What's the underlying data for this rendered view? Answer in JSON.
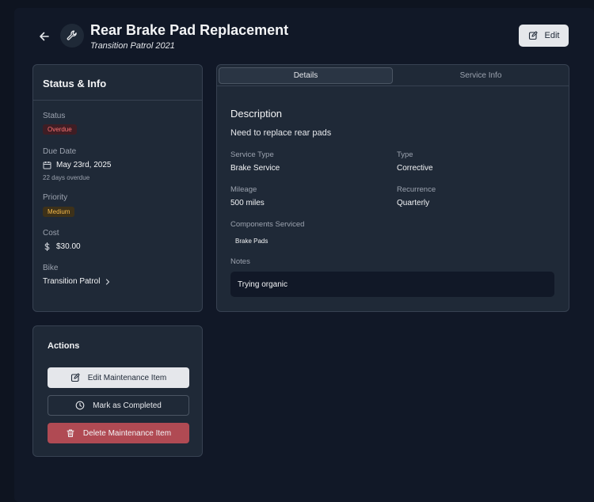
{
  "header": {
    "title": "Rear Brake Pad Replacement",
    "subtitle": "Transition Patrol 2021",
    "edit_label": "Edit",
    "back_icon": "arrow-left-icon",
    "header_icon": "wrench-icon"
  },
  "status_card": {
    "title": "Status & Info",
    "status_label": "Status",
    "status_value": "Overdue",
    "due_label": "Due Date",
    "due_value": "May 23rd, 2025",
    "due_note": "22 days overdue",
    "priority_label": "Priority",
    "priority_value": "Medium",
    "cost_label": "Cost",
    "cost_value": "$30.00",
    "bike_label": "Bike",
    "bike_value": "Transition Patrol"
  },
  "tabs": [
    "Details",
    "Service Info"
  ],
  "details": {
    "heading": "Description",
    "description": "Need to replace rear pads",
    "service_type_label": "Service Type",
    "service_type_value": "Brake Service",
    "type_label": "Type",
    "type_value": "Corrective",
    "mileage_label": "Mileage",
    "mileage_value": "500 miles",
    "recurrence_label": "Recurrence",
    "recurrence_value": "Quarterly",
    "components_label": "Components Serviced",
    "components": [
      "Brake Pads"
    ],
    "notes_label": "Notes",
    "notes_value": "Trying organic"
  },
  "actions": {
    "title": "Actions",
    "edit_label": "Edit Maintenance Item",
    "complete_label": "Mark as Completed",
    "delete_label": "Delete Maintenance Item"
  },
  "colors": {
    "background": "#111827",
    "card": "#1f2937",
    "overdue": "#f87171",
    "medium": "#f5b94a",
    "delete": "#b04a53"
  }
}
